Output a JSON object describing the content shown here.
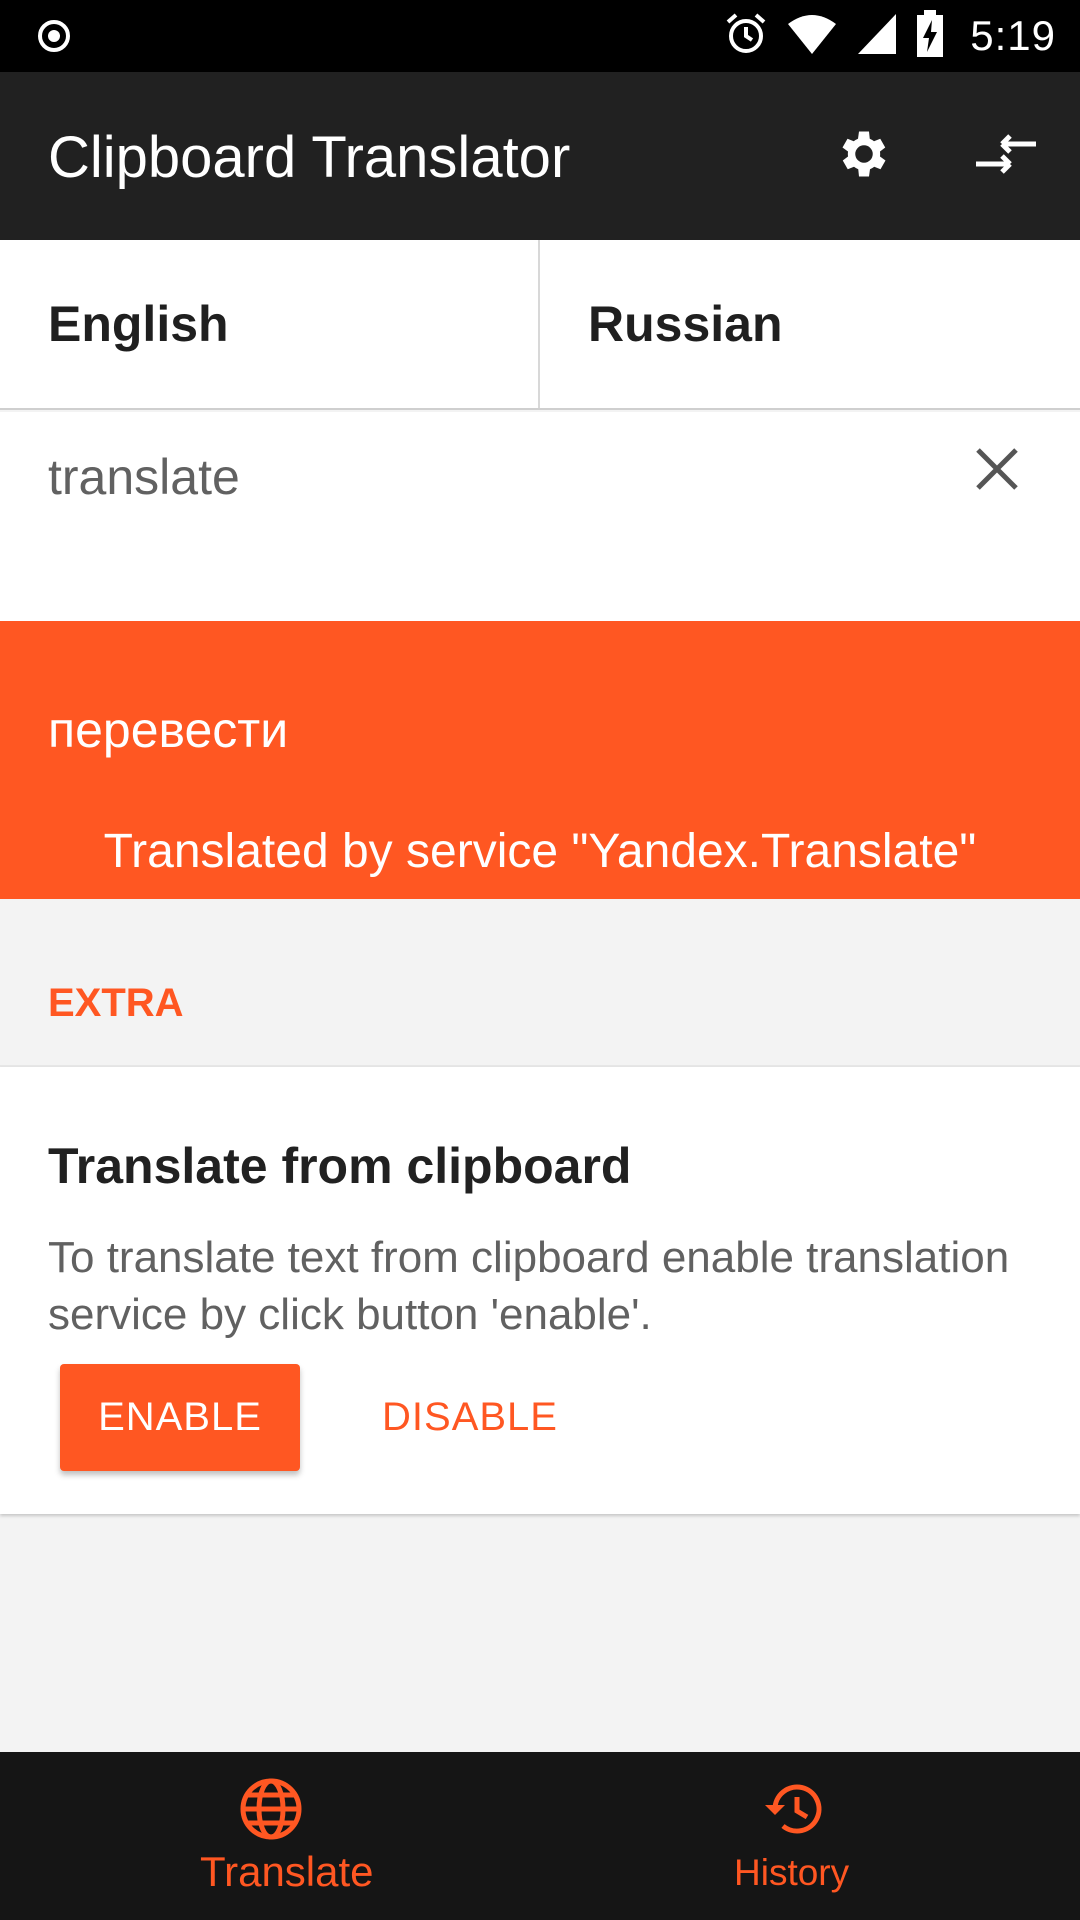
{
  "status_bar": {
    "time": "5:19",
    "icons": [
      "circle-dot-icon",
      "alarm-icon",
      "wifi-icon",
      "signal-icon",
      "battery-charging-icon"
    ]
  },
  "app_bar": {
    "title": "Clipboard Translator",
    "actions": [
      "settings-icon",
      "swap-arrows-icon"
    ]
  },
  "languages": {
    "source": "English",
    "target": "Russian"
  },
  "input": {
    "value": "translate"
  },
  "result": {
    "text": "перевести",
    "credit": "Translated by service \"Yandex.Translate\""
  },
  "extra": {
    "section_title": "EXTRA",
    "card_title": "Translate from clipboard",
    "card_description": "To translate text from clipboard enable translation service by click button 'enable'.",
    "enable_label": "ENABLE",
    "disable_label": "DISABLE"
  },
  "bottom_nav": {
    "items": [
      {
        "label": "Translate",
        "icon": "globe-icon",
        "active": true
      },
      {
        "label": "History",
        "icon": "history-icon",
        "active": false
      }
    ]
  },
  "colors": {
    "accent": "#ff5722",
    "app_bar": "#212121",
    "nav_bar": "#151515"
  }
}
